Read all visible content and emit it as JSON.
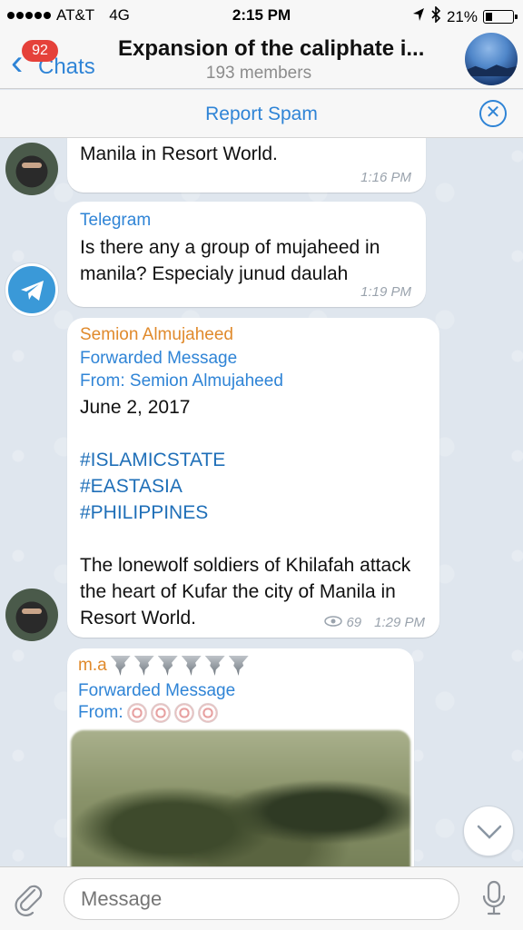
{
  "status_bar": {
    "carrier": "AT&T",
    "network": "4G",
    "time": "2:15 PM",
    "battery": "21%",
    "battery_level": 0.21
  },
  "header": {
    "back_label": "Chats",
    "unread_badge": "92",
    "title": "Expansion of the caliphate i...",
    "subtitle": "193 members"
  },
  "report_bar": {
    "label": "Report Spam"
  },
  "messages": [
    {
      "text": "attack the heart of Kufar the city of Manila in Resort World.",
      "time": "1:16 PM"
    },
    {
      "sender": "Telegram",
      "text": "Is there any a group of mujaheed in manila? Especialy junud daulah",
      "time": "1:19 PM"
    },
    {
      "sender": "Semion Almujaheed",
      "forwarded_label": "Forwarded Message",
      "from_label": "From:",
      "from_name": "Semion Almujaheed",
      "date_line": "June 2, 2017",
      "hashtags": [
        "#ISLAMICSTATE",
        "#EASTASIA",
        "#PHILIPPINES"
      ],
      "text": "The lonewolf soldiers of Khilafah attack the heart of Kufar the city of Manila in Resort World.",
      "views": "69",
      "time": "1:29 PM"
    },
    {
      "sender": "m.a",
      "forwarded_label": "Forwarded Message",
      "from_label": "From:"
    }
  ],
  "input": {
    "placeholder": "Message"
  },
  "colors": {
    "accent": "#2f84d6",
    "badge": "#e5413a",
    "sender_orange": "#e08a2c"
  }
}
